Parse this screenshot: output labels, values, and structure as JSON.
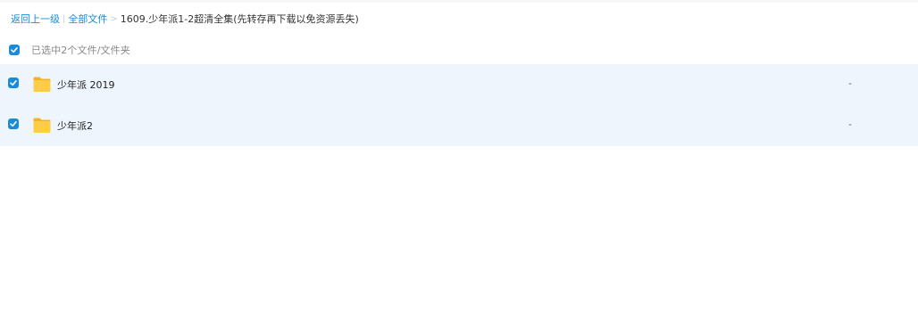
{
  "breadcrumb": {
    "back_label": "返回上一级",
    "divider": "|",
    "all_files_label": "全部文件",
    "separator": ">",
    "current_folder": "1609.少年派1-2超清全集(先转存再下载以免资源丢失)"
  },
  "selection": {
    "summary": "已选中2个文件/文件夹",
    "all_checked": true
  },
  "files": [
    {
      "name": "少年派 2019",
      "size": "-",
      "type": "folder",
      "checked": true
    },
    {
      "name": "少年派2",
      "size": "-",
      "type": "folder",
      "checked": true
    }
  ],
  "colors": {
    "accent": "#1a8bd8",
    "row_selected_bg": "#eef5fd",
    "folder_yellow": "#ffc940"
  },
  "icons": {
    "checkbox": "checkbox-checked-icon",
    "folder": "folder-icon"
  }
}
